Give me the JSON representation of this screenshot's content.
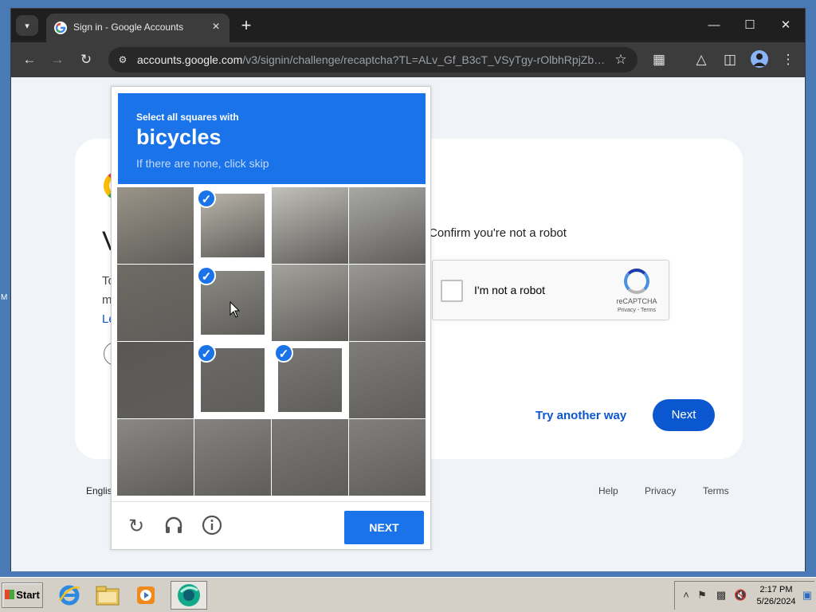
{
  "browser": {
    "tab_title": "Sign in - Google Accounts",
    "url_host": "accounts.google.com",
    "url_path": "/v3/signin/challenge/recaptcha?TL=ALv_Gf_B3cT_VSyTgy-rOlbhRpjZb4A..."
  },
  "page": {
    "heading_fragment": "V",
    "text_fragment_1": "To",
    "text_fragment_2": "m",
    "link_fragment": "Le",
    "chip_fragment": "G",
    "confirm_text": "Confirm you're not a robot",
    "recaptcha_widget": {
      "checkbox_label": "I'm not a robot",
      "brand": "reCAPTCHA",
      "privacy_terms": "Privacy - Terms"
    },
    "try_another_way": "Try another way",
    "next": "Next",
    "footer": {
      "language": "Englis",
      "help": "Help",
      "privacy": "Privacy",
      "terms": "Terms"
    }
  },
  "challenge": {
    "instruction": "Select all squares with",
    "target": "bicycles",
    "hint": "If there are none, click skip",
    "selected_tiles": [
      1,
      5,
      9,
      10
    ],
    "next_button": "NEXT"
  },
  "taskbar": {
    "start": "Start",
    "time": "2:17 PM",
    "date": "5/26/2024"
  },
  "colors": {
    "google_blue": "#0b57d0",
    "recaptcha_blue": "#1a73e8",
    "page_background": "#f0f4f9",
    "chrome_dark": "#3c3c3c"
  },
  "icons": [
    "tab-search-icon",
    "google-favicon-icon",
    "close-icon",
    "plus-icon",
    "minimize-icon",
    "maximize-icon",
    "back-icon",
    "forward-icon",
    "reload-icon",
    "site-info-icon",
    "star-icon",
    "extensions-icon",
    "labs-icon",
    "side-panel-icon",
    "profile-icon",
    "menu-icon",
    "reload-challenge-icon",
    "audio-challenge-icon",
    "info-icon",
    "internet-explorer-icon",
    "explorer-icon",
    "media-player-icon",
    "chrome-app-icon"
  ]
}
